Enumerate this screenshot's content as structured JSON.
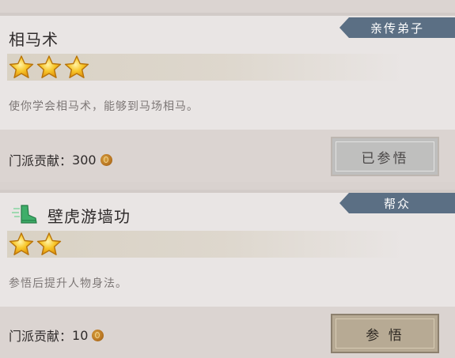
{
  "cards": [
    {
      "title": "相马术",
      "tag": "亲传弟子",
      "stars": 3,
      "description": "使你学会相马术，能够到马场相马。",
      "contribution_label": "门派贡献：",
      "contribution_value": "300",
      "button_label": "已参悟",
      "button_state": "done",
      "has_icon": false
    },
    {
      "title": "壁虎游墙功",
      "tag": "帮众",
      "stars": 2,
      "description": "参悟后提升人物身法。",
      "contribution_label": "门派贡献：",
      "contribution_value": "10",
      "button_label": "参 悟",
      "button_state": "active",
      "has_icon": true,
      "icon": "green-boot-icon"
    }
  ],
  "colors": {
    "tag_bg": "#5b6f84",
    "button_done_bg": "#bfbfbe",
    "button_active_bg": "#b7aa94",
    "star_gold": "#f6b81c"
  }
}
